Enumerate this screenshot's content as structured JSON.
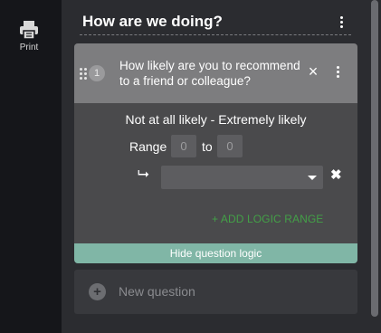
{
  "sidebar": {
    "print_label": "Print"
  },
  "survey": {
    "title": "How are we doing?"
  },
  "question": {
    "number": "1",
    "text_line1": "How likely are you to recommend",
    "text_line2": "to a friend or colleague?",
    "close_glyph": "×",
    "scale_label": "Not at all likely - Extremely likely",
    "range_label": "Range",
    "range_from": "0",
    "range_to_label": "to",
    "range_to": "0",
    "arrow_glyph": "⮡",
    "remove_glyph": "✖",
    "add_logic_range": "+ ADD LOGIC RANGE",
    "hide_logic": "Hide question logic"
  },
  "new_question": {
    "plus_glyph": "+",
    "label": "New question"
  },
  "colors": {
    "accent_green": "#43a047",
    "logic_bar": "#80b6a6"
  }
}
